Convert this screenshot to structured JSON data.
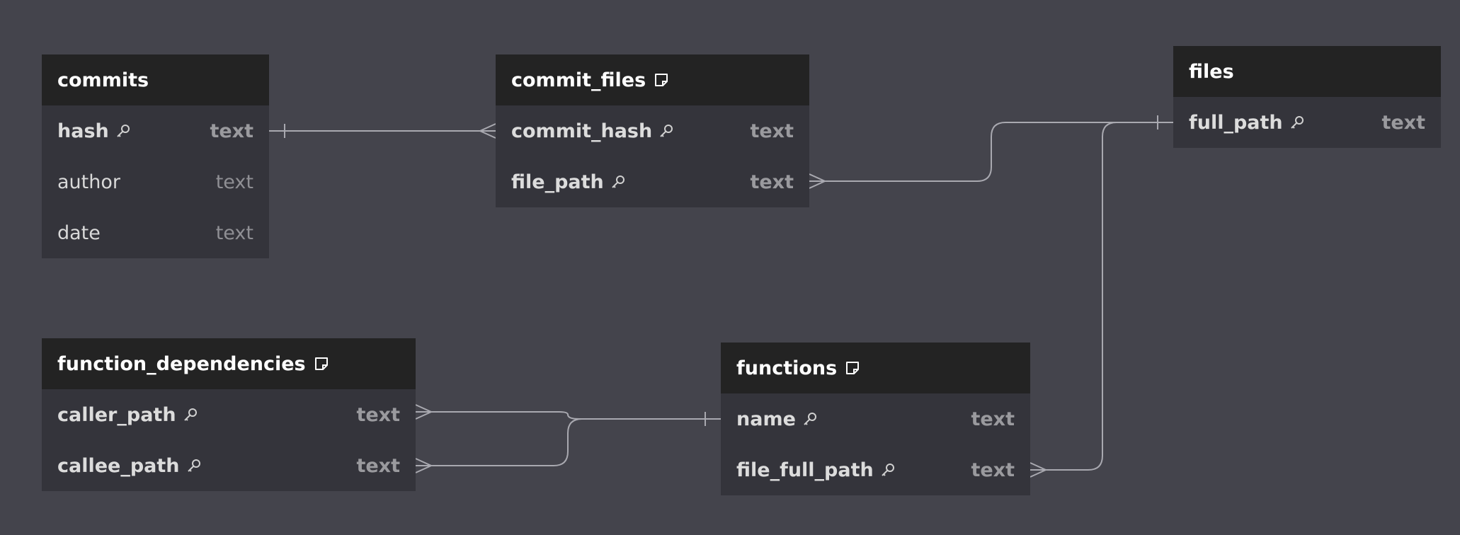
{
  "tables": {
    "commits": {
      "title": "commits",
      "rows": [
        {
          "name": "hash",
          "type": "text",
          "key": true
        },
        {
          "name": "author",
          "type": "text",
          "key": false
        },
        {
          "name": "date",
          "type": "text",
          "key": false
        }
      ]
    },
    "commit_files": {
      "title": "commit_files",
      "rows": [
        {
          "name": "commit_hash",
          "type": "text",
          "key": true
        },
        {
          "name": "file_path",
          "type": "text",
          "key": true
        }
      ]
    },
    "files": {
      "title": "files",
      "rows": [
        {
          "name": "full_path",
          "type": "text",
          "key": true
        }
      ]
    },
    "function_dependencies": {
      "title": "function_dependencies",
      "rows": [
        {
          "name": "caller_path",
          "type": "text",
          "key": true
        },
        {
          "name": "callee_path",
          "type": "text",
          "key": true
        }
      ]
    },
    "functions": {
      "title": "functions",
      "rows": [
        {
          "name": "name",
          "type": "text",
          "key": true
        },
        {
          "name": "file_full_path",
          "type": "text",
          "key": true
        }
      ]
    }
  },
  "relationships": [
    {
      "from": "commits.hash",
      "to": "commit_files.commit_hash",
      "cardinality": "one-to-many"
    },
    {
      "from": "files.full_path",
      "to": "commit_files.file_path",
      "cardinality": "one-to-many"
    },
    {
      "from": "files.full_path",
      "to": "functions.file_full_path",
      "cardinality": "one-to-many"
    },
    {
      "from": "functions.name",
      "to": "function_dependencies.caller_path",
      "cardinality": "one-to-many"
    },
    {
      "from": "functions.name",
      "to": "function_dependencies.callee_path",
      "cardinality": "one-to-many"
    }
  ],
  "colors": {
    "background": "#44444c",
    "header": "#232323",
    "body": "#34343b",
    "edge": "#a9a9b0"
  },
  "icons": {
    "key": "key-icon",
    "note": "note-icon"
  }
}
